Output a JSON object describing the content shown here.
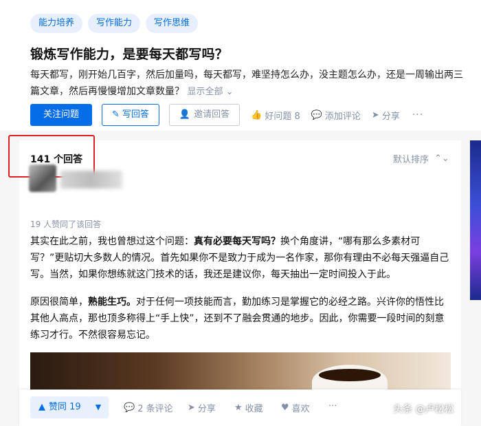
{
  "tags": [
    "能力培养",
    "写作能力",
    "写作思维"
  ],
  "question": {
    "title": "锻炼写作能力，是要每天都写吗？",
    "detail": "每天都写，刚开始几百字，然后加量吗，每天都写，难坚持怎么办，没主题怎么办，还是一周输出两三篇文章，然后再慢慢增加文章数量？",
    "show_all": "显示全部"
  },
  "actions": {
    "follow": "关注问题",
    "write": "写回答",
    "invite": "邀请回答",
    "good_question": "好问题 8",
    "add_comment": "添加评论",
    "share": "分享",
    "more": "···"
  },
  "answers": {
    "count_label": "141 个回答",
    "sort_label": "默认排序"
  },
  "answer": {
    "votes_note": "19 人赞同了该回答",
    "p1_a": "其实在此之前，我也曾想过这个问题：",
    "p1_bold": "真有必要每天写吗？",
    "p1_b": "换个角度讲，“哪有那么多素材可写？”更贴切大多数人的情况。首先如果你不是致力于成为一名作家，那你有理由不必每天强逼自己写。当然，如果你想练就这门技术的话，我还是建议你，每天抽出一定时间投入于此。",
    "p2_a": "原因很简单，",
    "p2_bold": "熟能生巧。",
    "p2_b": "对于任何一项技能而言，勤加练习是掌握它的必经之路。兴许你的悟性比其他人高点，那也顶多称得上“手上快”，还到不了融会贯通的地步。因此，你需要一段时间的刻意练习才行。不然很容易忘记。"
  },
  "bottom_bar": {
    "upvote": "赞同 19",
    "comments": "2 条评论",
    "share": "分享",
    "favorite": "收藏",
    "like": "喜欢",
    "more": "···"
  },
  "watermark": "头条 @卢松松",
  "colors": {
    "accent": "#056de8",
    "muted": "#8590a6",
    "highlight_box": "#e02020"
  }
}
